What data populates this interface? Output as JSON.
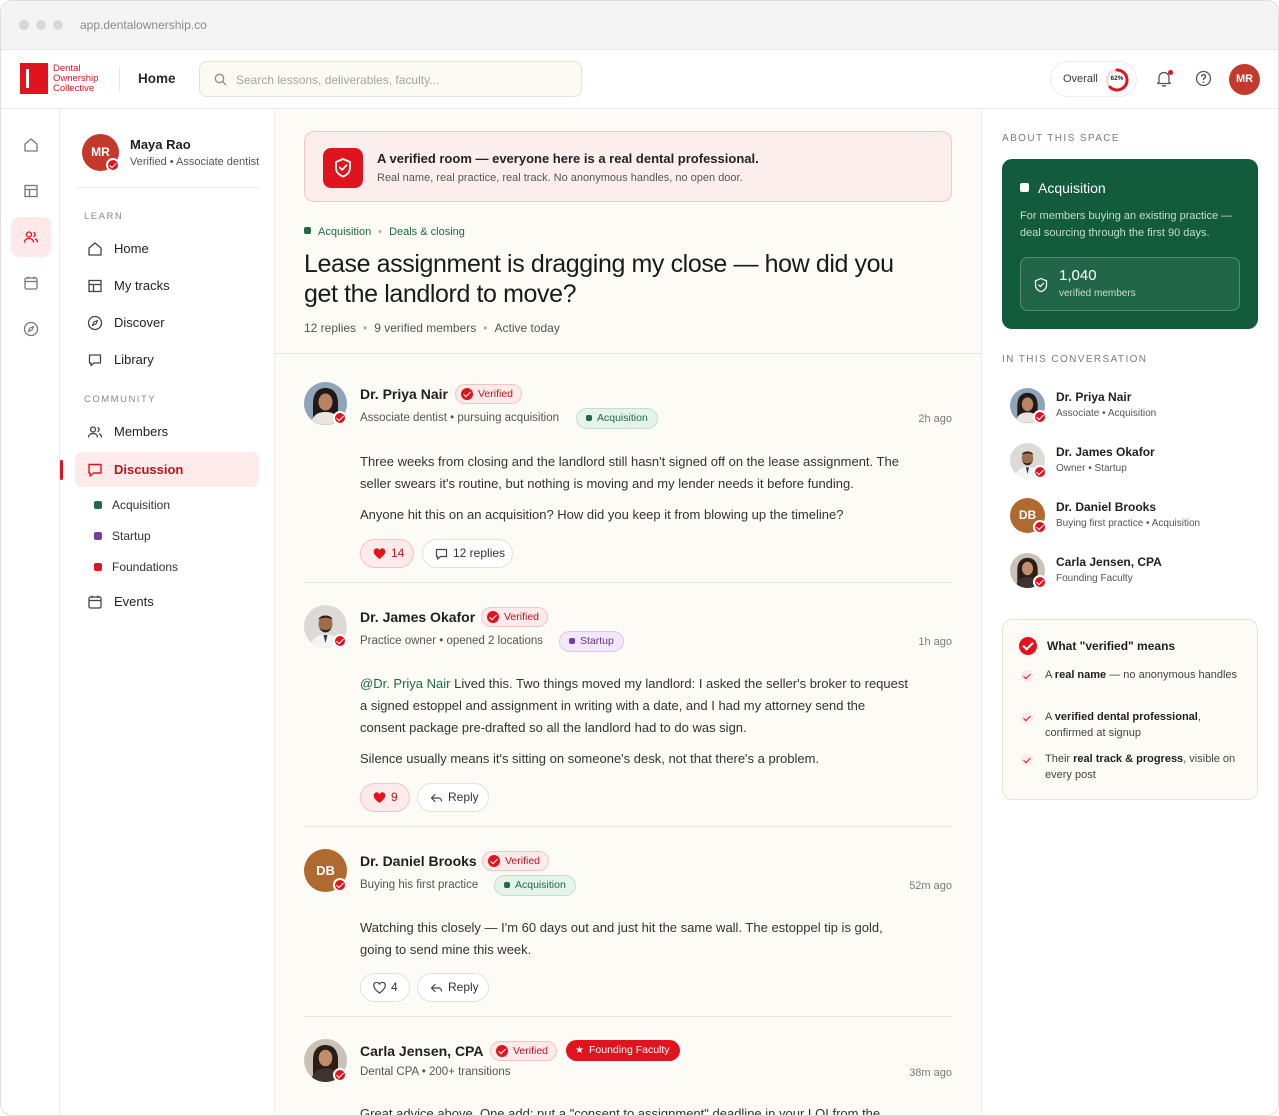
{
  "browser": {
    "url": "app.dentalownership.co"
  },
  "brand": {
    "line1": "Dental",
    "line2": "Ownership",
    "line3": "Collective",
    "color": "#e0141e"
  },
  "topbar": {
    "breadcrumb": "Home",
    "search_placeholder": "Search lessons, deliverables, faculty...",
    "overall_label": "Overall",
    "overall_pct": "62%",
    "overall_value": 0.62,
    "user_initials": "MR"
  },
  "user": {
    "initials": "MR",
    "name": "Maya Rao",
    "subtitle": "Verified • Associate dentist"
  },
  "nav": {
    "learn_label": "LEARN",
    "learn_items": [
      "Home",
      "My tracks",
      "Discover",
      "Library"
    ],
    "community_label": "COMMUNITY",
    "members": "Members",
    "discussion": "Discussion",
    "spaces": [
      {
        "label": "Acquisition",
        "color": "#1e6a44"
      },
      {
        "label": "Startup",
        "color": "#7b3aa8"
      },
      {
        "label": "Foundations",
        "color": "#e0141e"
      }
    ],
    "events": "Events"
  },
  "banner": {
    "title": "A verified room — everyone here is a real dental professional.",
    "subtitle": "Real name, real practice, real track. No anonymous handles, no open door."
  },
  "thread": {
    "space": "Acquisition",
    "topic": "Deals & closing",
    "title": "Lease assignment is dragging my close — how did you get the landlord to move?",
    "replies": "12 replies",
    "members": "9 verified members",
    "activity": "Active today"
  },
  "posts": [
    {
      "name": "Dr. Priya Nair",
      "verified": "Verified",
      "role": "Associate dentist • pursuing acquisition",
      "tag": "Acquisition",
      "time": "2h ago",
      "p1": "Three weeks from closing and the landlord still hasn't signed off on the lease assignment. The seller swears it's routine, but nothing is moving and my lender needs it before funding.",
      "p2": "Anyone hit this on an acquisition? How did you keep it from blowing up the timeline?",
      "likes": "14",
      "replies": "12 replies"
    },
    {
      "name": "Dr. James Okafor",
      "verified": "Verified",
      "role": "Practice owner • opened 2 locations",
      "tag": "Startup",
      "time": "1h ago",
      "mention": "@Dr. Priya Nair",
      "p1": " Lived this. Two things moved my landlord: I asked the seller's broker to request a signed estoppel and assignment in writing with a date, and I had my attorney send the consent package pre-drafted so all the landlord had to do was sign.",
      "p2": "Silence usually means it's sitting on someone's desk, not that there's a problem.",
      "likes": "9",
      "reply": "Reply"
    },
    {
      "initials": "DB",
      "name": "Dr. Daniel Brooks",
      "verified": "Verified",
      "role": "Buying his first practice",
      "tag": "Acquisition",
      "time": "52m ago",
      "p1": "Watching this closely — I'm 60 days out and just hit the same wall. The estoppel tip is gold, going to send mine this week.",
      "likes": "4",
      "reply": "Reply"
    },
    {
      "name": "Carla Jensen, CPA",
      "verified": "Verified",
      "badge": "Founding Faculty",
      "role": "Dental CPA • 200+ transitions",
      "time": "38m ago",
      "p1": "Great advice above. One add: put a \"consent to assignment\" deadline in your LOI from the"
    }
  ],
  "aside": {
    "about_label": "ABOUT THIS SPACE",
    "space_name": "Acquisition",
    "space_desc": "For members buying an existing practice — deal sourcing through the first 90 days.",
    "member_count": "1,040",
    "member_label": "verified members",
    "conv_label": "IN THIS CONVERSATION",
    "people": [
      {
        "name": "Dr. Priya Nair",
        "role": "Associate • Acquisition"
      },
      {
        "name": "Dr. James Okafor",
        "role": "Owner • Startup"
      },
      {
        "initials": "DB",
        "name": "Dr. Daniel Brooks",
        "role": "Buying first practice • Acquisition"
      },
      {
        "name": "Carla Jensen, CPA",
        "role": "Founding Faculty"
      }
    ],
    "verified_title": "What \"verified\" means",
    "v1_pre": "A ",
    "v1_b": "real name",
    "v1_post": " — no anonymous handles",
    "v2_pre": "A ",
    "v2_b": "verified dental professional",
    "v2_post": ", confirmed at signup",
    "v3_pre": "Their ",
    "v3_b": "real track & progress",
    "v3_post": ", visible on every post"
  }
}
